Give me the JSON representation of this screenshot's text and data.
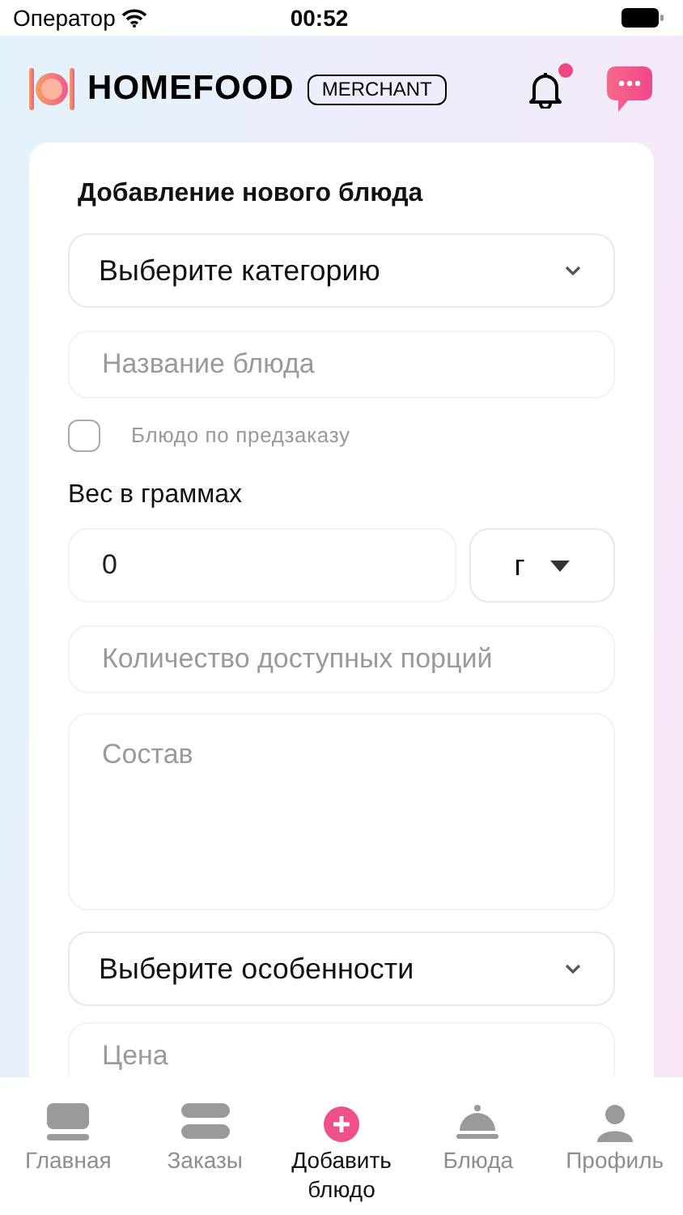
{
  "status_bar": {
    "carrier": "Оператор",
    "time": "00:52"
  },
  "header": {
    "brand": "HOMEFOOD",
    "badge": "MERCHANT",
    "notification_unread": true
  },
  "form": {
    "title": "Добавление нового блюда",
    "category": {
      "value": "Выберите категорию"
    },
    "name": {
      "placeholder": "Название блюда"
    },
    "preorder": {
      "label": "Блюдо по предзаказу",
      "checked": false
    },
    "weight": {
      "label": "Вес в граммах",
      "value": "0",
      "unit": "г"
    },
    "portions": {
      "placeholder": "Количество доступных порций"
    },
    "composition": {
      "placeholder": "Состав"
    },
    "features": {
      "value": "Выберите особенности"
    },
    "price": {
      "placeholder": "Цена"
    }
  },
  "tab_bar": [
    {
      "label": "Главная",
      "selected": false
    },
    {
      "label": "Заказы",
      "selected": false
    },
    {
      "label": "Добавить блюдо",
      "selected": true
    },
    {
      "label": "Блюда",
      "selected": false
    },
    {
      "label": "Профиль",
      "selected": false
    }
  ]
}
